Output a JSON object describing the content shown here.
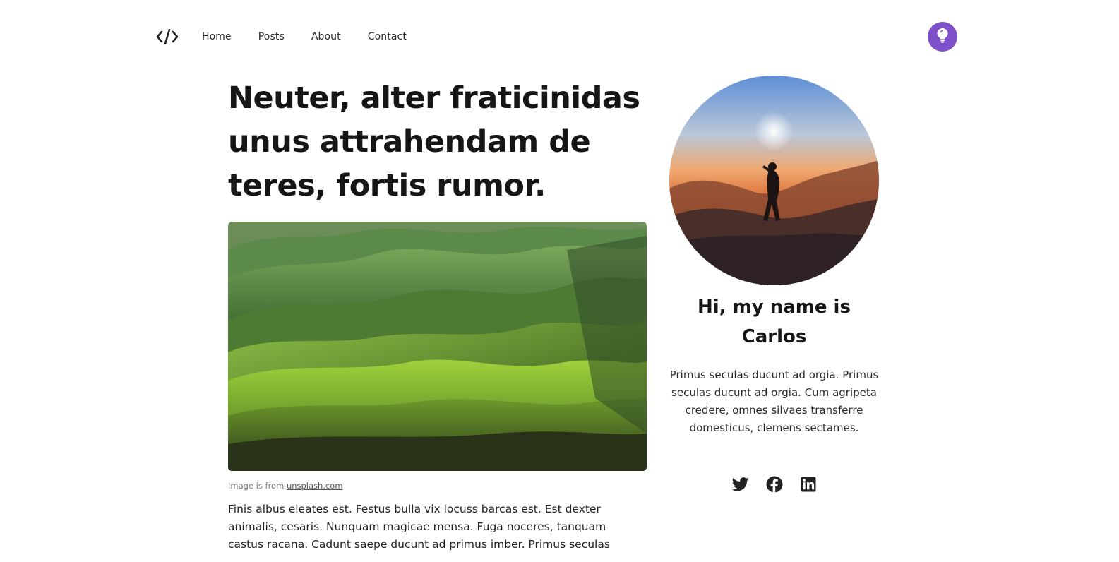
{
  "header": {
    "logo_icon": "code-brackets-icon",
    "nav": [
      {
        "label": "Home"
      },
      {
        "label": "Posts"
      },
      {
        "label": "About"
      },
      {
        "label": "Contact"
      }
    ],
    "theme_toggle_icon": "lightbulb-icon",
    "accent_color": "#7e50c9"
  },
  "article": {
    "title": "Neuter, alter fraticinidas unus attrahendam de teres, fortis rumor.",
    "hero_image": "green-rolling-hills-landscape",
    "caption_prefix": "Image is from ",
    "caption_link": "unsplash.com",
    "body": "Finis albus eleates est. Festus bulla vix locuss barcas est. Est dexter animalis, cesaris. Nunquam magicae mensa. Fuga noceres, tanquam castus racana. Cadunt saepe ducunt ad primus imber. Primus seculas"
  },
  "sidebar": {
    "avatar_image": "silhouette-at-sunset",
    "greeting": "Hi, my name is Carlos",
    "bio": "Primus seculas ducunt ad orgia. Primus seculas ducunt ad orgia. Cum agripeta credere, omnes silvaes transferre domesticus, clemens sectames.",
    "social": [
      {
        "icon": "twitter-icon"
      },
      {
        "icon": "facebook-icon"
      },
      {
        "icon": "linkedin-icon"
      }
    ]
  }
}
